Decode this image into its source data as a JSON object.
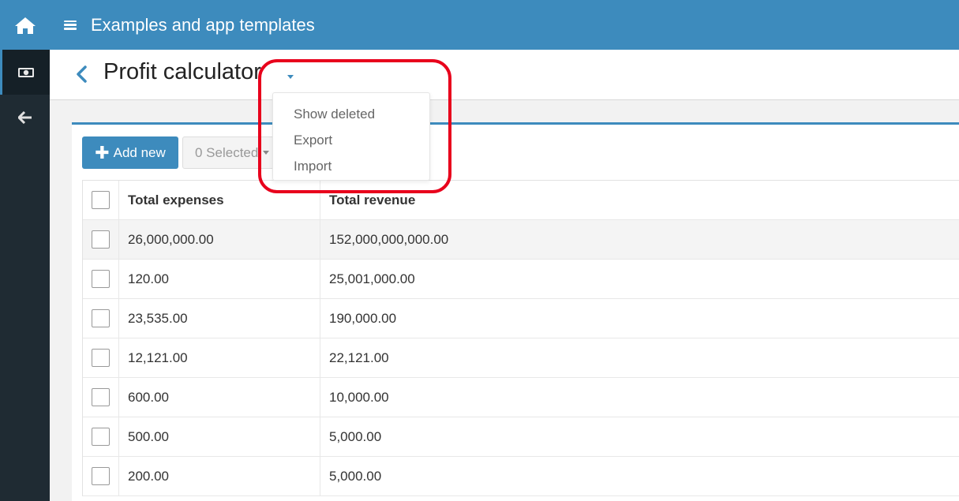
{
  "topbar": {
    "title": "Examples and app templates"
  },
  "page": {
    "title": "Profit calculator"
  },
  "toolbar": {
    "add_label": "Add new",
    "selected_label": "0 Selected"
  },
  "dropdown": {
    "items": [
      "Show deleted",
      "Export",
      "Import"
    ]
  },
  "table": {
    "columns": [
      "Total expenses",
      "Total revenue"
    ],
    "rows": [
      [
        "26,000,000.00",
        "152,000,000,000.00"
      ],
      [
        "120.00",
        "25,001,000.00"
      ],
      [
        "23,535.00",
        "190,000.00"
      ],
      [
        "12,121.00",
        "22,121.00"
      ],
      [
        "600.00",
        "10,000.00"
      ],
      [
        "500.00",
        "5,000.00"
      ],
      [
        "200.00",
        "5,000.00"
      ]
    ]
  },
  "colors": {
    "accent": "#3d8bbd",
    "sidebar": "#1f2b33",
    "highlight": "#e8001c"
  },
  "icons": {
    "home": "home-icon",
    "money": "money-icon",
    "back": "arrow-left-icon",
    "menu": "hamburger-icon"
  }
}
